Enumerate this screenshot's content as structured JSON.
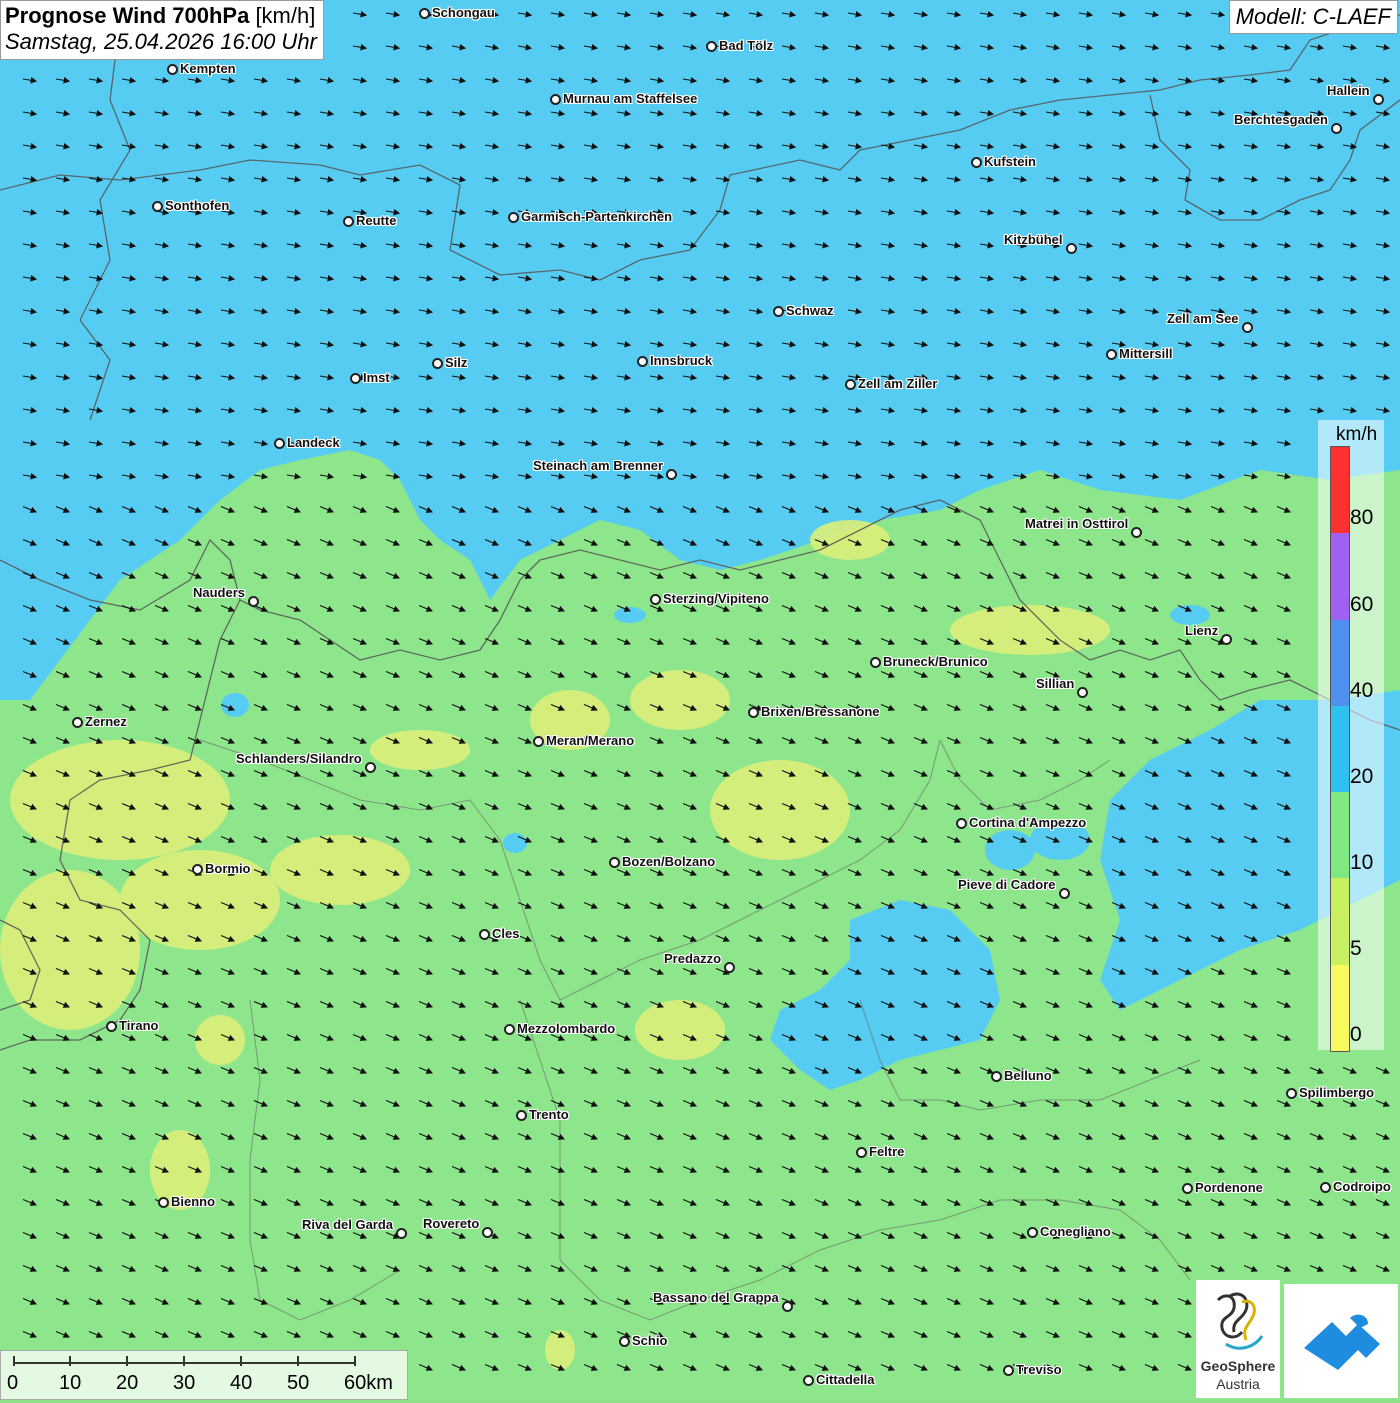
{
  "title": {
    "main": "Prognose Wind 700hPa",
    "unit": "[km/h]",
    "datetime": "Samstag, 25.04.2026 16:00 Uhr"
  },
  "model": "Modell: C-LAEF",
  "legend": {
    "unit": "km/h",
    "labels": [
      "80",
      "60",
      "40",
      "20",
      "10",
      "5",
      "0"
    ],
    "colors": [
      "#ff3030",
      "#a060f0",
      "#5090f0",
      "#30c0f0",
      "#80e880",
      "#c8f060",
      "#f8f860"
    ]
  },
  "scale": {
    "labels": [
      "0",
      "10",
      "20",
      "30",
      "40",
      "50",
      "60km"
    ]
  },
  "logos": {
    "geosphere_line1": "GeoSphere",
    "geosphere_line2": "Austria"
  },
  "colors": {
    "strong": "#56ccf2",
    "moderate": "#8ee68c",
    "weak": "#dcee7a",
    "border": "#555555"
  },
  "cities": [
    {
      "name": "Schongau",
      "side": "right"
    },
    {
      "name": "Bad Tölz",
      "side": "right"
    },
    {
      "name": "Kempten",
      "side": "right"
    },
    {
      "name": "Murnau am Staffelsee",
      "side": "right"
    },
    {
      "name": "Hallein",
      "side": "left"
    },
    {
      "name": "Berchtesgaden",
      "side": "left"
    },
    {
      "name": "Kufstein",
      "side": "right"
    },
    {
      "name": "Sonthofen",
      "side": "right"
    },
    {
      "name": "Reutte",
      "side": "right"
    },
    {
      "name": "Garmisch-Partenkirchen",
      "side": "right"
    },
    {
      "name": "Kitzbühel",
      "side": "left"
    },
    {
      "name": "Schwaz",
      "side": "right"
    },
    {
      "name": "Zell am See",
      "side": "left"
    },
    {
      "name": "Innsbruck",
      "side": "right"
    },
    {
      "name": "Silz",
      "side": "right"
    },
    {
      "name": "Mittersill",
      "side": "right"
    },
    {
      "name": "Imst",
      "side": "right"
    },
    {
      "name": "Zell am Ziller",
      "side": "right"
    },
    {
      "name": "Landeck",
      "side": "right"
    },
    {
      "name": "Steinach am Brenner",
      "side": "left"
    },
    {
      "name": "Matrei in Osttirol",
      "side": "left"
    },
    {
      "name": "Nauders",
      "side": "left"
    },
    {
      "name": "Sterzing/Vipiteno",
      "side": "right"
    },
    {
      "name": "Lienz",
      "side": "left"
    },
    {
      "name": "Bruneck/Brunico",
      "side": "right"
    },
    {
      "name": "Sillian",
      "side": "left"
    },
    {
      "name": "Brixen/Bressanone",
      "side": "right"
    },
    {
      "name": "Zernez",
      "side": "right"
    },
    {
      "name": "Meran/Merano",
      "side": "right"
    },
    {
      "name": "Schlanders/Silandro",
      "side": "left"
    },
    {
      "name": "Cortina d'Ampezzo",
      "side": "right"
    },
    {
      "name": "Bozen/Bolzano",
      "side": "right"
    },
    {
      "name": "Bormio",
      "side": "right"
    },
    {
      "name": "Pieve di Cadore",
      "side": "left"
    },
    {
      "name": "Cles",
      "side": "right"
    },
    {
      "name": "Predazzo",
      "side": "left"
    },
    {
      "name": "Tirano",
      "side": "right"
    },
    {
      "name": "Mezzolombardo",
      "side": "right"
    },
    {
      "name": "Belluno",
      "side": "right"
    },
    {
      "name": "Spilimbergo",
      "side": "right"
    },
    {
      "name": "Trento",
      "side": "right"
    },
    {
      "name": "Feltre",
      "side": "right"
    },
    {
      "name": "Pordenone",
      "side": "right"
    },
    {
      "name": "Codroipo",
      "side": "right"
    },
    {
      "name": "Bienno",
      "side": "right"
    },
    {
      "name": "Riva del Garda",
      "side": "left"
    },
    {
      "name": "Rovereto",
      "side": "left"
    },
    {
      "name": "Conegliano",
      "side": "right"
    },
    {
      "name": "Bassano del Grappa",
      "side": "left"
    },
    {
      "name": "Schio",
      "side": "right"
    },
    {
      "name": "Treviso",
      "side": "right"
    },
    {
      "name": "Cittadella",
      "side": "right"
    }
  ]
}
